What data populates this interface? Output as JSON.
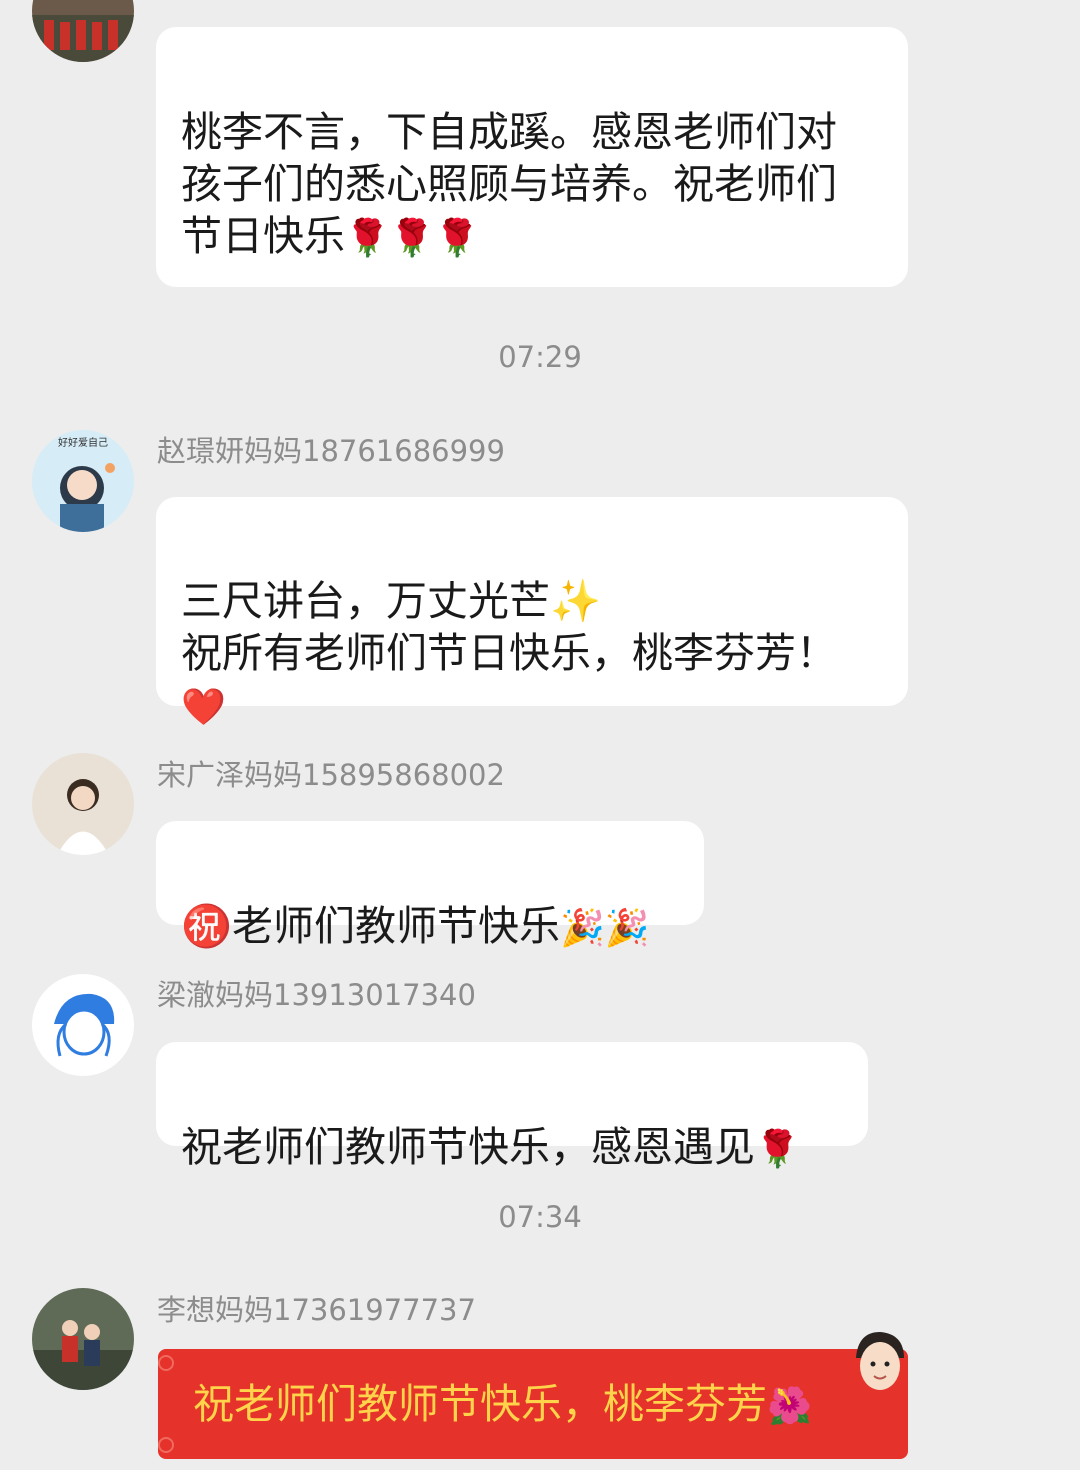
{
  "messages": [
    {
      "sender": "",
      "text": "桃李不言，下自成蹊。感恩老师们对\n孩子们的悉心照顾与培养。祝老师们\n节日快乐",
      "emoji": "🌹🌹🌹"
    },
    {
      "sender": "赵璟妍妈妈18761686999",
      "text": "三尺讲台，万丈光芒✨\n祝所有老师们节日快乐，桃李芬芳！\n",
      "emoji": "❤️"
    },
    {
      "sender": "宋广泽妈妈15895868002",
      "text": "㊗️老师们教师节快乐",
      "emoji": "🎉🎉"
    },
    {
      "sender": "梁澈妈妈13913017340",
      "text": "祝老师们教师节快乐，感恩遇见",
      "emoji": "🌹"
    },
    {
      "sender": "李想妈妈17361977737",
      "text": "祝老师们教师节快乐，桃李芬芳",
      "emoji": "🌺"
    }
  ],
  "timestamps": [
    "07:29",
    "07:34"
  ],
  "avatar_image_badge": "好好爱自己",
  "colors": {
    "background": "#ededed",
    "bubble": "#ffffff",
    "meta_text": "#8c8c8c",
    "red_packet": "#e5322a",
    "red_packet_text": "#ffd34a"
  }
}
